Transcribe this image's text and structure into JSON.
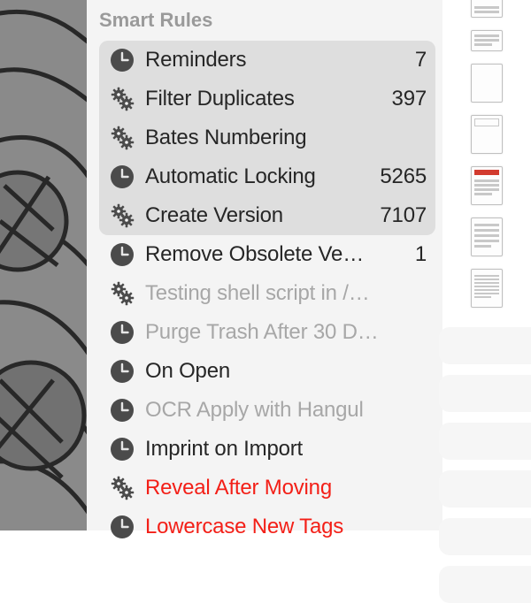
{
  "section_title": "Smart Rules",
  "icons": {
    "clock": "clock-icon",
    "gears": "gears-icon"
  },
  "rules": [
    {
      "icon": "clock",
      "label": "Reminders",
      "count": "7",
      "selected": true
    },
    {
      "icon": "gears",
      "label": "Filter Duplicates",
      "count": "397",
      "selected": true
    },
    {
      "icon": "gears",
      "label": "Bates Numbering",
      "count": "",
      "selected": true
    },
    {
      "icon": "clock",
      "label": "Automatic Locking",
      "count": "5265",
      "selected": true
    },
    {
      "icon": "gears",
      "label": "Create Version",
      "count": "7107",
      "selected": true
    },
    {
      "icon": "clock",
      "label": "Remove Obsolete Ve…",
      "count": "1"
    },
    {
      "icon": "gears",
      "label": "Testing shell script in /…",
      "dim": true
    },
    {
      "icon": "clock",
      "label": "Purge Trash After 30 D…",
      "dim": true
    },
    {
      "icon": "clock",
      "label": "On Open"
    },
    {
      "icon": "clock",
      "label": "OCR Apply with Hangul",
      "dim": true
    },
    {
      "icon": "clock",
      "label": "Imprint on Import"
    },
    {
      "icon": "gears",
      "label": "Reveal After Moving",
      "alert": true
    },
    {
      "icon": "clock",
      "label": "Lowercase New Tags",
      "alert": true
    }
  ],
  "thumbnails": [
    {
      "kind": "at",
      "name": "thumb-at"
    },
    {
      "kind": "short",
      "name": "thumb-note"
    },
    {
      "kind": "blank",
      "name": "thumb-blank"
    },
    {
      "kind": "head",
      "name": "thumb-head"
    },
    {
      "kind": "red",
      "name": "thumb-red"
    },
    {
      "kind": "lines",
      "name": "thumb-lines"
    },
    {
      "kind": "text",
      "name": "thumb-text"
    }
  ],
  "row_placeholders": 6
}
